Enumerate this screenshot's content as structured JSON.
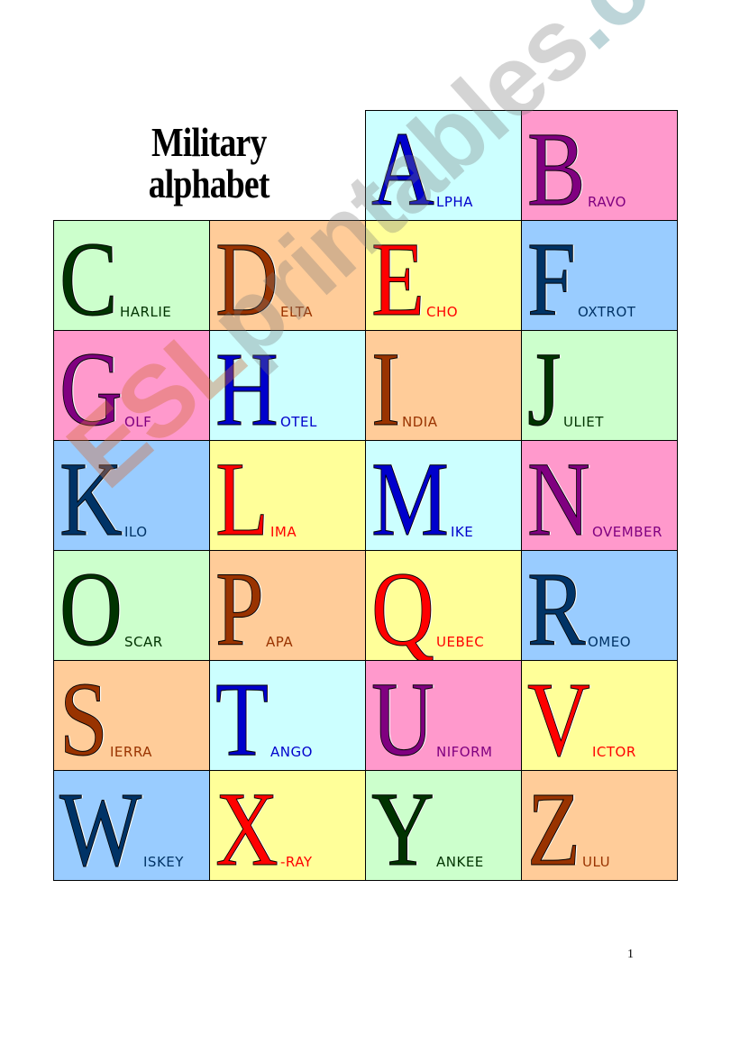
{
  "title": {
    "line1": "Military",
    "line2": "alphabet"
  },
  "page_number": "1",
  "watermark": {
    "part1": "ESL",
    "part2": "printables",
    "part3": ".com"
  },
  "letters": [
    {
      "letter": "A",
      "rest": "LPHA",
      "bg": "#ccffff",
      "color": "#0000cc"
    },
    {
      "letter": "B",
      "rest": "RAVO",
      "bg": "#ff99cc",
      "color": "#800080"
    },
    {
      "letter": "C",
      "rest": "HARLIE",
      "bg": "#ccffcc",
      "color": "#003300"
    },
    {
      "letter": "D",
      "rest": "ELTA",
      "bg": "#ffcc99",
      "color": "#993300"
    },
    {
      "letter": "E",
      "rest": "CHO",
      "bg": "#ffff99",
      "color": "#ff0000"
    },
    {
      "letter": "F",
      "rest": "OXTROT",
      "bg": "#99ccff",
      "color": "#003366"
    },
    {
      "letter": "G",
      "rest": "OLF",
      "bg": "#ff99cc",
      "color": "#800080"
    },
    {
      "letter": "H",
      "rest": "OTEL",
      "bg": "#ccffff",
      "color": "#0000cc"
    },
    {
      "letter": "I",
      "rest": "NDIA",
      "bg": "#ffcc99",
      "color": "#993300"
    },
    {
      "letter": "J",
      "rest": "ULIET",
      "bg": "#ccffcc",
      "color": "#003300"
    },
    {
      "letter": "K",
      "rest": "ILO",
      "bg": "#99ccff",
      "color": "#003366"
    },
    {
      "letter": "L",
      "rest": "IMA",
      "bg": "#ffff99",
      "color": "#ff0000"
    },
    {
      "letter": "M",
      "rest": "IKE",
      "bg": "#ccffff",
      "color": "#0000cc"
    },
    {
      "letter": "N",
      "rest": "OVEMBER",
      "bg": "#ff99cc",
      "color": "#800080"
    },
    {
      "letter": "O",
      "rest": "SCAR",
      "bg": "#ccffcc",
      "color": "#003300"
    },
    {
      "letter": "P",
      "rest": "APA",
      "bg": "#ffcc99",
      "color": "#993300"
    },
    {
      "letter": "Q",
      "rest": "UEBEC",
      "bg": "#ffff99",
      "color": "#ff0000"
    },
    {
      "letter": "R",
      "rest": "OMEO",
      "bg": "#99ccff",
      "color": "#003366"
    },
    {
      "letter": "S",
      "rest": "IERRA",
      "bg": "#ffcc99",
      "color": "#993300"
    },
    {
      "letter": "T",
      "rest": "ANGO",
      "bg": "#ccffff",
      "color": "#0000cc"
    },
    {
      "letter": "U",
      "rest": "NIFORM",
      "bg": "#ff99cc",
      "color": "#800080"
    },
    {
      "letter": "V",
      "rest": "ICTOR",
      "bg": "#ffff99",
      "color": "#ff0000"
    },
    {
      "letter": "W",
      "rest": "ISKEY",
      "bg": "#99ccff",
      "color": "#003366"
    },
    {
      "letter": "X",
      "rest": "-RAY",
      "bg": "#ffff99",
      "color": "#ff0000"
    },
    {
      "letter": "Y",
      "rest": "ANKEE",
      "bg": "#ccffcc",
      "color": "#003300"
    },
    {
      "letter": "Z",
      "rest": "ULU",
      "bg": "#ffcc99",
      "color": "#993300"
    }
  ]
}
